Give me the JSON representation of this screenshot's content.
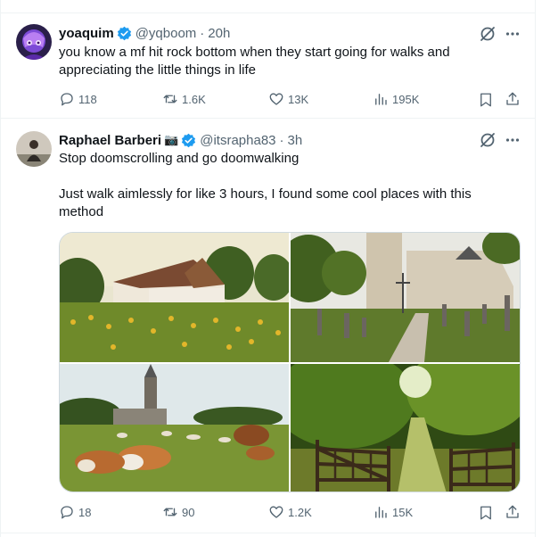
{
  "tweets": [
    {
      "name": "yoaquim",
      "handle": "@yqboom",
      "separator": "·",
      "time": "20h",
      "text_lines": [
        "you know a mf hit rock bottom when they start going for walks and",
        "appreciating the little things in life"
      ],
      "replies": "118",
      "reposts": "1.6K",
      "likes": "13K",
      "views": "195K"
    },
    {
      "name": "Raphael Barberi",
      "name_emoji": "📷",
      "handle": "@itsrapha83",
      "separator": "·",
      "time": "3h",
      "text_lines": [
        "Stop doomscrolling and go doomwalking",
        "",
        "Just walk aimlessly for like 3 hours, I found some cool places with this",
        "method"
      ],
      "replies": "18",
      "reposts": "90",
      "likes": "1.2K",
      "views": "15K",
      "media": [
        "farmhouse-sunflower-field-photo",
        "church-cemetery-photo",
        "cows-grazing-meadow-photo",
        "wooden-gate-forest-path-photo"
      ]
    }
  ],
  "colors": {
    "text": "#0f1419",
    "secondary": "#536471",
    "verified": "#1d9bf0",
    "border": "#eff3f4"
  },
  "icons": [
    "verified-badge-icon",
    "grok-icon",
    "more-icon",
    "reply-icon",
    "repost-icon",
    "like-icon",
    "views-icon",
    "bookmark-icon",
    "share-icon"
  ]
}
